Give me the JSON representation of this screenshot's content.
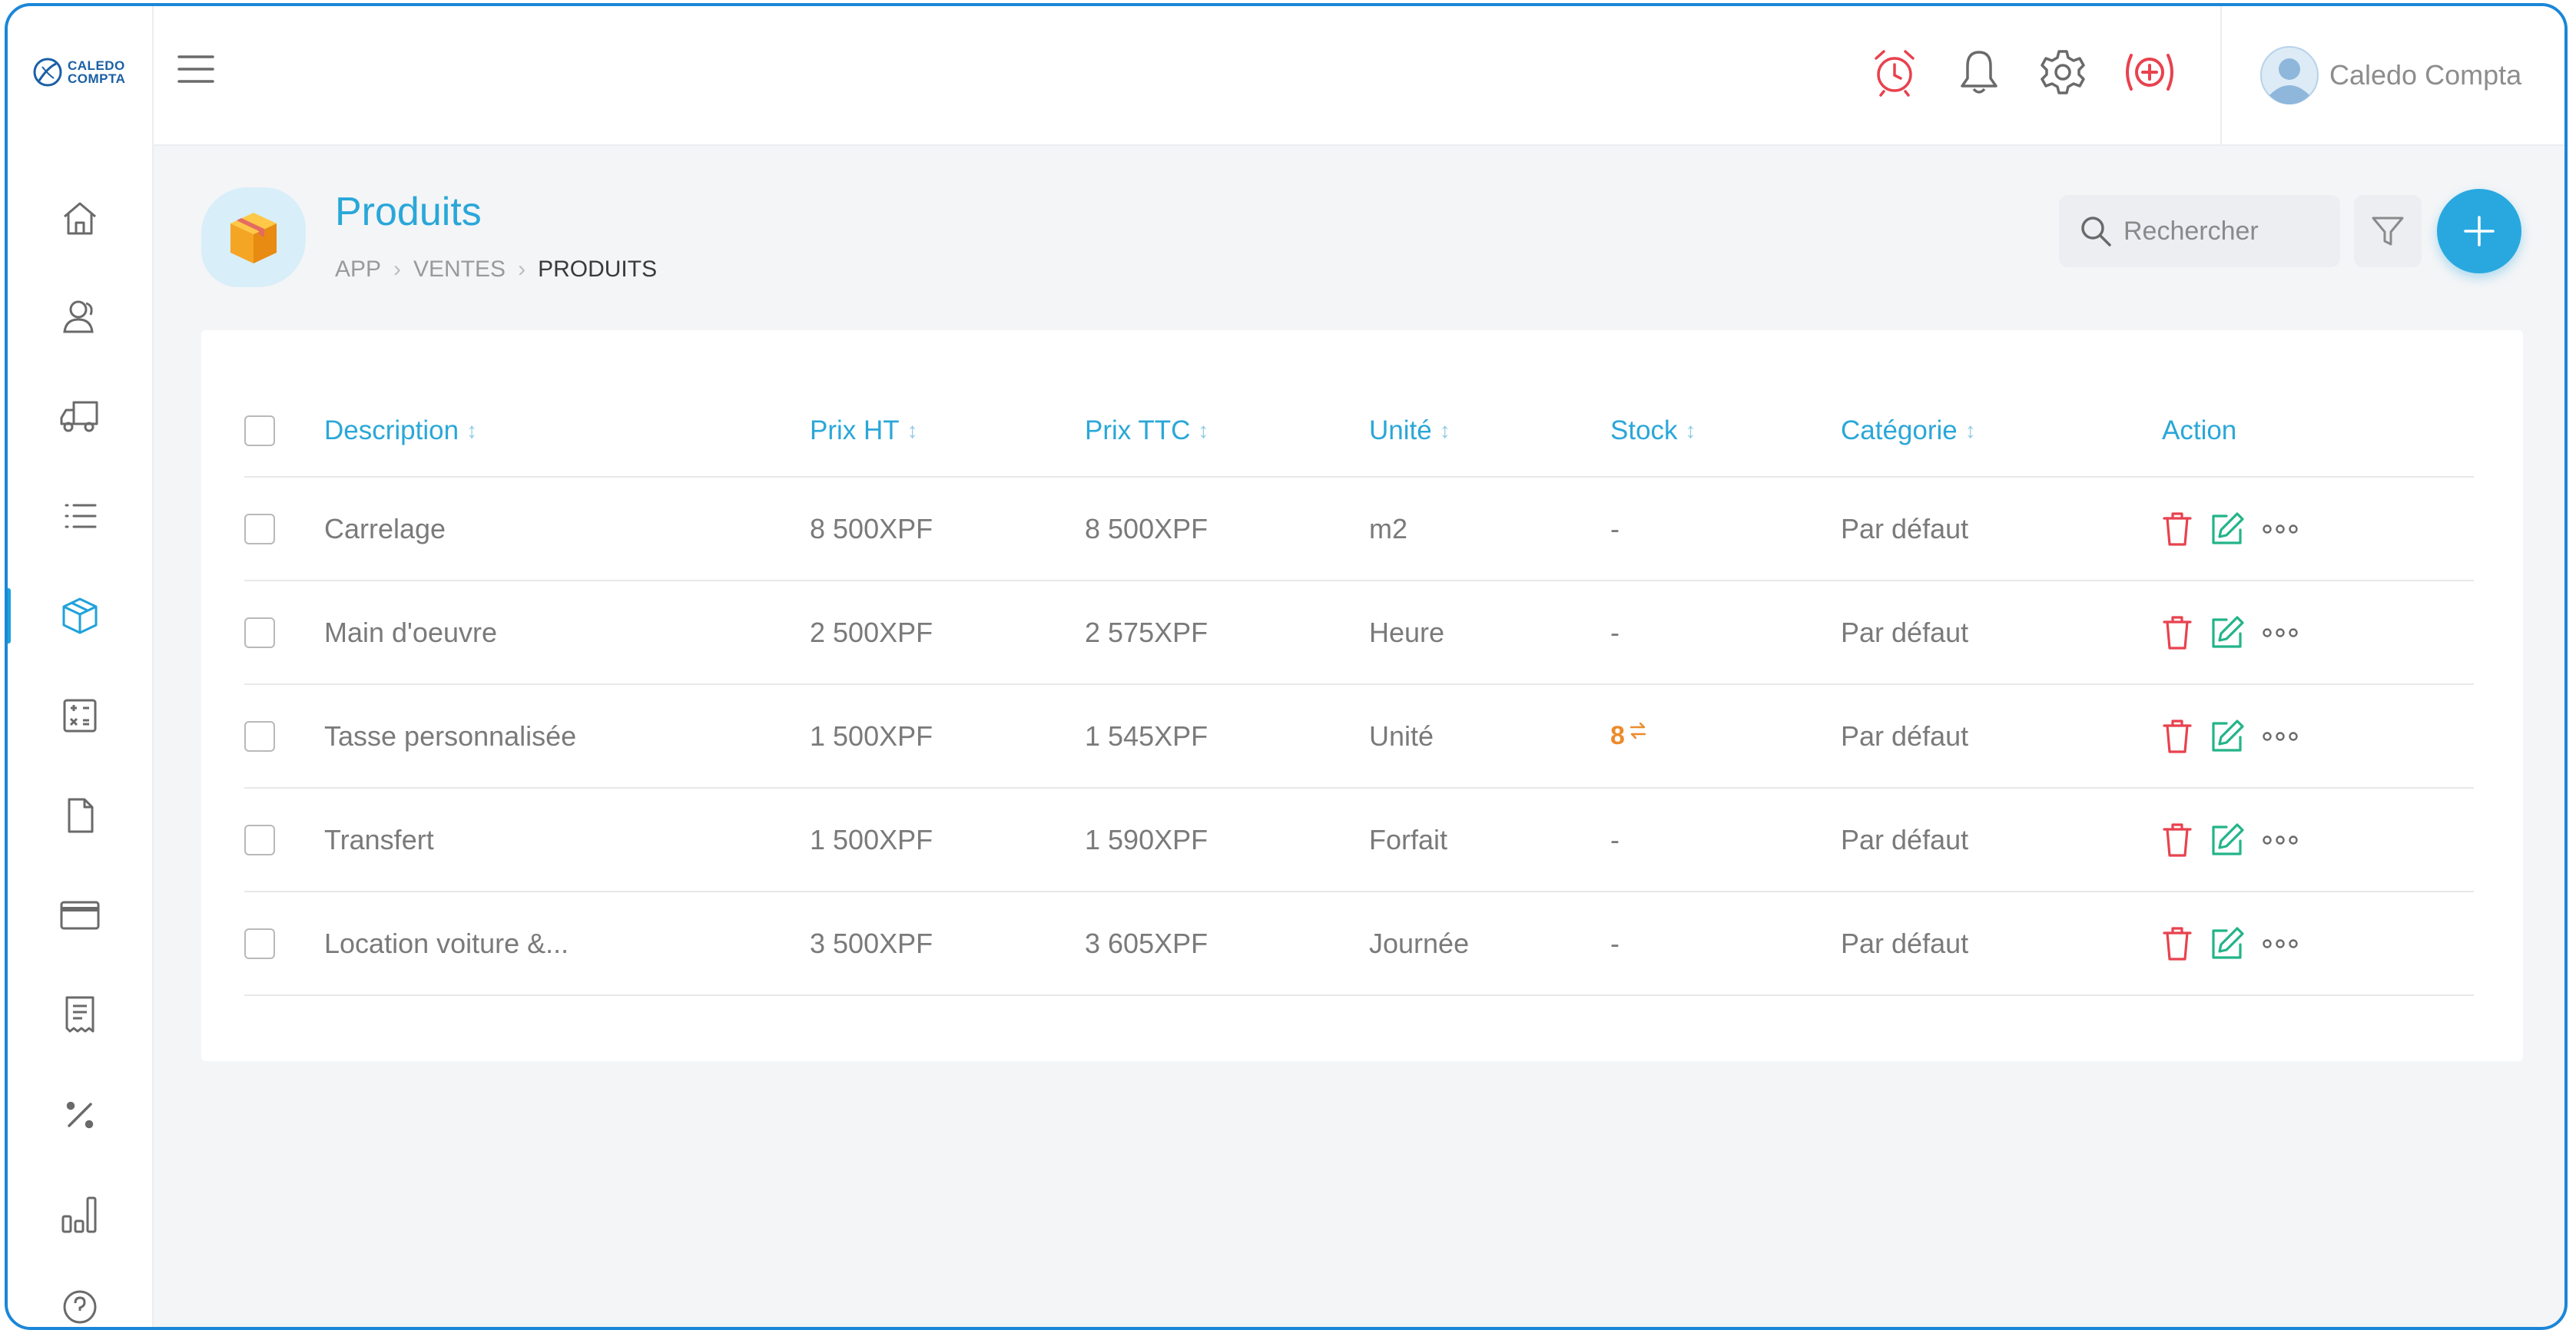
{
  "app": {
    "logo_line1": "CALEDO",
    "logo_line2": "COMPTA",
    "user_name": "Caledo Compta"
  },
  "header_icons": [
    "alarm-clock-icon",
    "bell-icon",
    "gear-icon",
    "help-ring-icon"
  ],
  "sidebar": {
    "items": [
      {
        "name": "home",
        "icon": "home-icon"
      },
      {
        "name": "contacts",
        "icon": "users-icon"
      },
      {
        "name": "delivery",
        "icon": "truck-icon"
      },
      {
        "name": "list",
        "icon": "list-icon"
      },
      {
        "name": "products",
        "icon": "box-icon",
        "active": true
      },
      {
        "name": "calculator",
        "icon": "calculator-icon"
      },
      {
        "name": "documents",
        "icon": "file-icon"
      },
      {
        "name": "payments",
        "icon": "credit-card-icon"
      },
      {
        "name": "receipts",
        "icon": "receipt-icon"
      },
      {
        "name": "taxes",
        "icon": "percent-icon"
      },
      {
        "name": "reports",
        "icon": "bar-chart-icon"
      },
      {
        "name": "help",
        "icon": "help-icon"
      }
    ]
  },
  "page": {
    "title": "Produits",
    "breadcrumb": [
      "APP",
      "VENTES",
      "PRODUITS"
    ]
  },
  "search": {
    "placeholder": "Rechercher"
  },
  "table": {
    "columns": [
      "Description",
      "Prix HT",
      "Prix TTC",
      "Unité",
      "Stock",
      "Catégorie",
      "Action"
    ],
    "rows": [
      {
        "description": "Carrelage",
        "prix_ht": "8 500XPF",
        "prix_ttc": "8 500XPF",
        "unite": "m2",
        "stock": "-",
        "categorie": "Par défaut"
      },
      {
        "description": "Main d'oeuvre",
        "prix_ht": "2 500XPF",
        "prix_ttc": "2 575XPF",
        "unite": "Heure",
        "stock": "-",
        "categorie": "Par défaut"
      },
      {
        "description": "Tasse personnalisée",
        "prix_ht": "1 500XPF",
        "prix_ttc": "1 545XPF",
        "unite": "Unité",
        "stock": "8",
        "categorie": "Par défaut"
      },
      {
        "description": "Transfert",
        "prix_ht": "1 500XPF",
        "prix_ttc": "1 590XPF",
        "unite": "Forfait",
        "stock": "-",
        "categorie": "Par défaut"
      },
      {
        "description": "Location voiture &...",
        "prix_ht": "3 500XPF",
        "prix_ttc": "3 605XPF",
        "unite": "Journée",
        "stock": "-",
        "categorie": "Par défaut"
      }
    ]
  },
  "colors": {
    "accent": "#29a8e0",
    "danger": "#e8424e",
    "edit": "#22b489",
    "stock": "#ec8b2c",
    "frame": "#1b86d8"
  }
}
